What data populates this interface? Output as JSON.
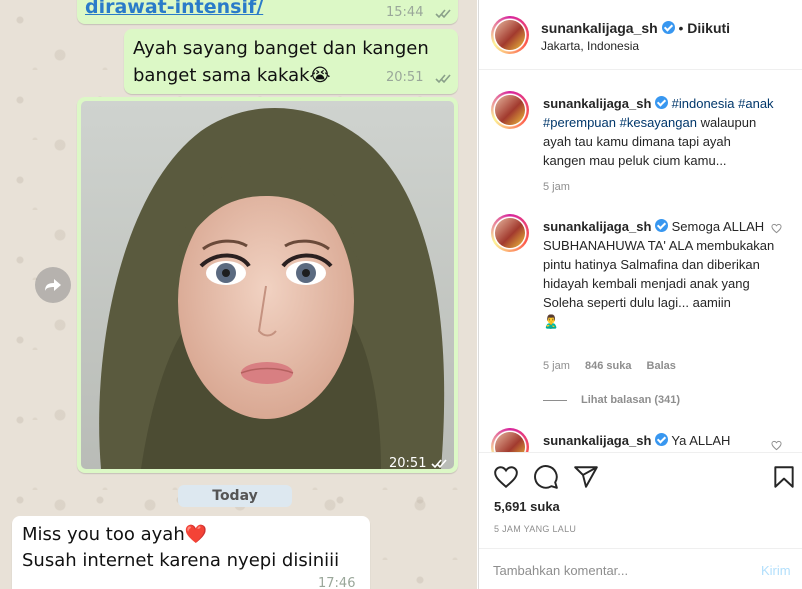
{
  "chat": {
    "link_message": {
      "text": "dirawat-intensif/",
      "time": "15:44"
    },
    "message_1": {
      "text": "Ayah sayang banget dan kangen banget sama kakak😭",
      "time": "20:51"
    },
    "photo_message": {
      "time": "20:51"
    },
    "date_separator": "Today",
    "message_2": {
      "line1": "Miss you too ayah❤️",
      "line2": "Susah internet karena nyepi disiniii",
      "time": "17:46"
    }
  },
  "post": {
    "header": {
      "username": "sunankalijaga_sh",
      "dot": "•",
      "follow_status": "Diikuti",
      "location": "Jakarta, Indonesia"
    },
    "caption": {
      "username": "sunankalijaga_sh",
      "hashtags": "#indonesia #anak #perempuan #kesayangan",
      "text": " walaupun ayah tau kamu dimana tapi ayah kangen mau peluk cium kamu...",
      "time": "5 jam"
    },
    "comment_1": {
      "username": "sunankalijaga_sh",
      "text": "Semoga ALLAH SUBHANAHUWA TA' ALA membukakan pintu hatinya Salmafina dan diberikan hidayah kembali menjadi anak yang Soleha seperti dulu lagi... aamiin",
      "emoji": "🙎‍♂️",
      "time": "5 jam",
      "likes": "846 suka",
      "reply": "Balas",
      "view_replies": "Lihat balasan (341)"
    },
    "comment_2": {
      "username": "sunankalijaga_sh",
      "text": "Ya ALLAH"
    },
    "likes": "5,691 suka",
    "time_ago": "5 JAM YANG LALU",
    "add_comment": {
      "placeholder": "Tambahkan komentar...",
      "post_label": "Kirim"
    },
    "colors": {
      "link": "#00376b",
      "verified": "#3897f0",
      "outgoing_bubble": "#dcf8c6"
    }
  }
}
